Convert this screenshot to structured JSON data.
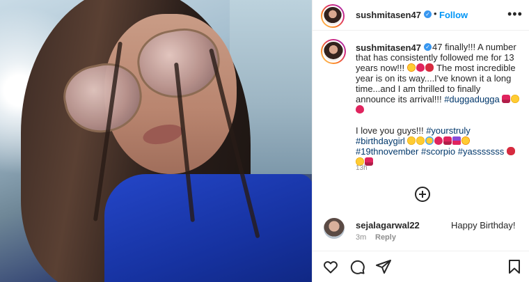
{
  "header": {
    "username": "sushmitasen47",
    "verified_mark": "✓",
    "separator": "•",
    "follow_label": "Follow",
    "more_label": "•••"
  },
  "caption": {
    "username": "sushmitasen47",
    "line1": "47 finally!!! A number that has consistently followed me for 13 years now!!!",
    "line2": "The most incredible year is on its way....I've known it a long time...and I am thrilled to finally announce its arrival!!!",
    "hashtag1": "#duggadugga",
    "line3": "I love you guys!!!",
    "hashtag2": "#yourstruly",
    "hashtag3": "#birthdaygirl",
    "hashtag4": "#19thnovember",
    "hashtag5": "#scorpio",
    "hashtag6": "#yasssssss",
    "time": "13h"
  },
  "comment": {
    "username": "sejalagarwal22",
    "text": "Happy Birthday!",
    "time": "3m",
    "reply_label": "Reply"
  },
  "icons": {
    "like": "heart-icon",
    "comment": "comment-icon",
    "share": "share-icon",
    "save": "bookmark-icon",
    "load_more": "plus-circle-icon"
  },
  "colors": {
    "follow_blue": "#0095f6",
    "hashtag_blue": "#00376b",
    "verified_blue": "#3897f0",
    "muted_gray": "#8e8e8e"
  }
}
